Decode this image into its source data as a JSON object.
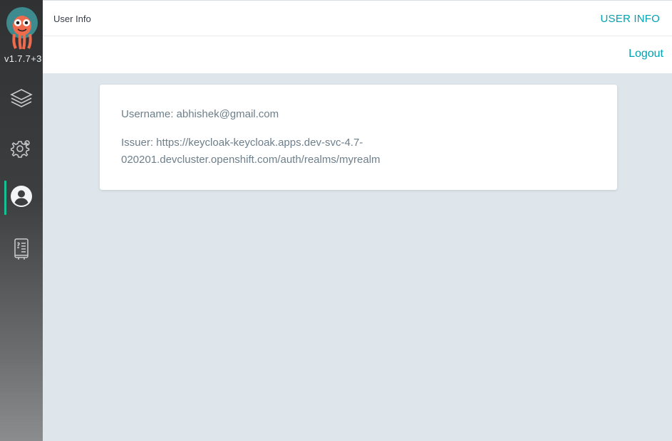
{
  "sidebar": {
    "version": "v1.7.7+3",
    "items": [
      {
        "icon": "layers-icon",
        "active": false
      },
      {
        "icon": "gear-icon",
        "active": false
      },
      {
        "icon": "user-icon",
        "active": true
      },
      {
        "icon": "docs-icon",
        "active": false
      }
    ]
  },
  "header": {
    "title": "User Info",
    "tab_label": "USER INFO"
  },
  "toolbar": {
    "logout_label": "Logout"
  },
  "user_info": {
    "username_line": "Username: abhishek@gmail.com",
    "issuer_line1": "Issuer: https://keycloak-keycloak.apps.dev-svc-4.7-",
    "issuer_line2": "020201.devcluster.openshift.com/auth/realms/myrealm"
  },
  "colors": {
    "accent": "#00a2b3",
    "active_indicator": "#18be94",
    "background": "#dee6eb"
  }
}
